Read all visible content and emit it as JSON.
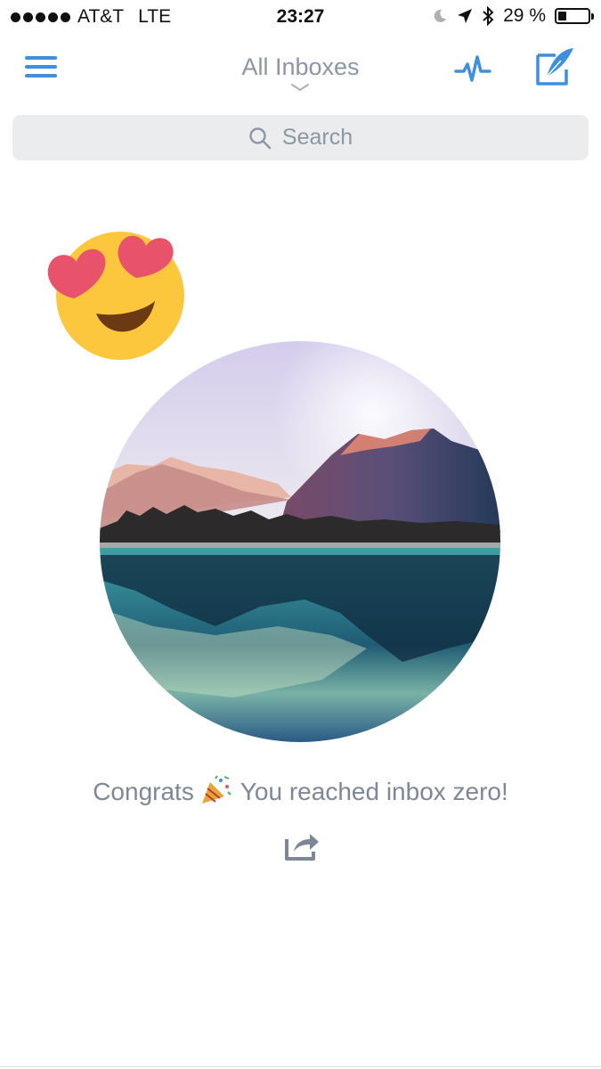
{
  "status_bar": {
    "carrier": "AT&T",
    "network": "LTE",
    "time": "23:27",
    "battery_percent": "29 %",
    "battery_level": 0.29,
    "icons": [
      "signal-dots-icon",
      "moon-icon",
      "location-arrow-icon",
      "bluetooth-icon",
      "battery-icon"
    ]
  },
  "nav": {
    "title": "All Inboxes",
    "icons": [
      "hamburger-menu-icon",
      "chevron-down-icon",
      "activity-pulse-icon",
      "compose-feather-icon"
    ]
  },
  "search": {
    "placeholder": "Search",
    "icon": "search-icon"
  },
  "empty_state": {
    "emoji": "heart-eyes-emoji",
    "image": "mountain-lake-landscape",
    "message_before": "Congrats",
    "message_after": "You reached inbox zero!",
    "party_icon": "party-popper-icon",
    "share_icon": "share-icon"
  },
  "colors": {
    "accent": "#3d8fe0",
    "title_gray": "#8a96a6",
    "search_bg": "#ebecee",
    "emoji_yellow": "#fcc73c",
    "heart_red": "#e8526a"
  }
}
